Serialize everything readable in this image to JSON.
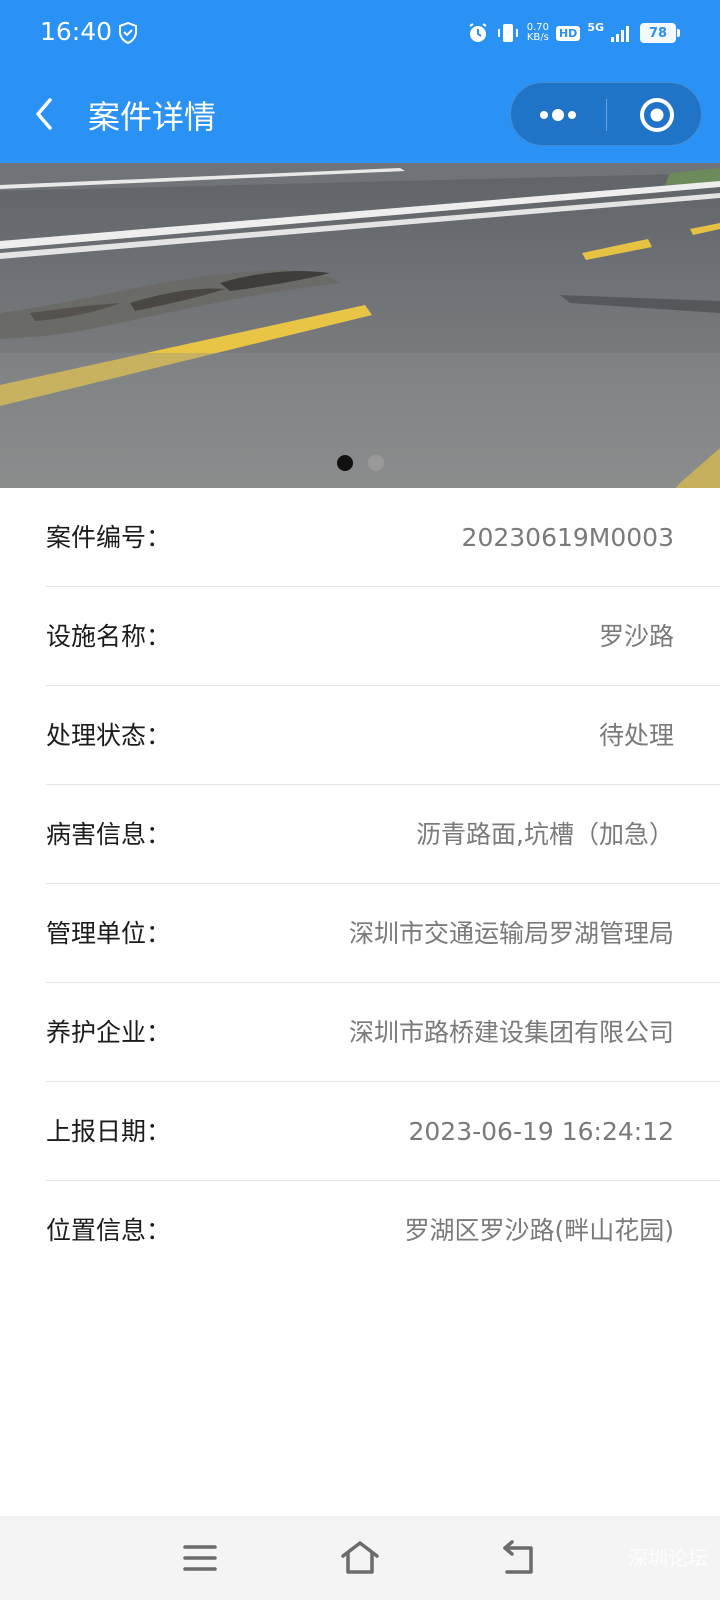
{
  "status_bar": {
    "time": "16:40",
    "net_speed_value": "0.70",
    "net_speed_unit": "KB/s",
    "hd_label": "HD",
    "network_label": "5G",
    "battery": "78"
  },
  "nav": {
    "title": "案件详情"
  },
  "banner": {
    "slide_count": 2,
    "active_index": 0
  },
  "details": [
    {
      "label": "案件编号：",
      "value": "20230619M0003"
    },
    {
      "label": "设施名称：",
      "value": "罗沙路"
    },
    {
      "label": "处理状态：",
      "value": "待处理"
    },
    {
      "label": "病害信息：",
      "value": "沥青路面,坑槽（加急）"
    },
    {
      "label": "管理单位：",
      "value": "深圳市交通运输局罗湖管理局"
    },
    {
      "label": "养护企业：",
      "value": "深圳市路桥建设集团有限公司"
    },
    {
      "label": "上报日期：",
      "value": "2023-06-19 16:24:12"
    },
    {
      "label": "位置信息：",
      "value": "罗湖区罗沙路(畔山花园)"
    }
  ],
  "watermark": "深圳论坛",
  "colors": {
    "header_bg": "#2a91f5",
    "label_text": "#1c1c1c",
    "value_text": "#7a7a7a",
    "bottom_nav_bg": "#f4f4f4"
  }
}
